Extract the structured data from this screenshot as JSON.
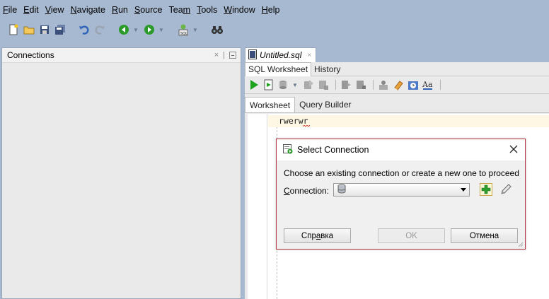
{
  "menu": [
    {
      "label": "File",
      "mnemonic": "F",
      "rest": "ile"
    },
    {
      "label": "Edit",
      "mnemonic": "E",
      "rest": "dit"
    },
    {
      "label": "View",
      "mnemonic": "V",
      "rest": "iew"
    },
    {
      "label": "Navigate",
      "mnemonic": "N",
      "rest": "avigate"
    },
    {
      "label": "Run",
      "mnemonic": "R",
      "rest": "un"
    },
    {
      "label": "Source",
      "mnemonic": "S",
      "rest": "ource"
    },
    {
      "label": "Team",
      "pre": "Tea",
      "mnemonic": "m"
    },
    {
      "label": "Tools",
      "mnemonic": "T",
      "rest": "ools"
    },
    {
      "label": "Window",
      "mnemonic": "W",
      "rest": "indow"
    },
    {
      "label": "Help",
      "mnemonic": "H",
      "rest": "elp"
    }
  ],
  "toolbar": {
    "icons": [
      "new-file-icon",
      "open-folder-icon",
      "save-icon",
      "save-all-icon",
      "undo-icon",
      "redo-icon",
      "back-icon",
      "forward-icon",
      "sql-connection-icon",
      "binoculars-icon"
    ]
  },
  "connections_panel": {
    "title": "Connections",
    "close_glyph": "×",
    "separator_glyph": "|"
  },
  "editor": {
    "doc_tab": {
      "label": "Untitled.sql",
      "close_glyph": "×"
    },
    "sub_tabs": [
      "SQL Worksheet",
      "History"
    ],
    "ws_tabs": [
      "Worksheet",
      "Query Builder"
    ],
    "code_line": "rwerwr",
    "colors": {
      "current_line": "#fdf7e3",
      "run_green": "#1ea31e"
    }
  },
  "dialog": {
    "title": "Select Connection",
    "message": "Choose an existing connection or create a new one to proceed",
    "connection_label_mnemonic": "C",
    "connection_label_rest": "onnection:",
    "connection_value": "",
    "buttons": {
      "help_pre": "Спр",
      "help_mnemonic": "а",
      "help_post": "вка",
      "ok": "OK",
      "cancel": "Отмена"
    },
    "border_color": "#b3373f"
  }
}
